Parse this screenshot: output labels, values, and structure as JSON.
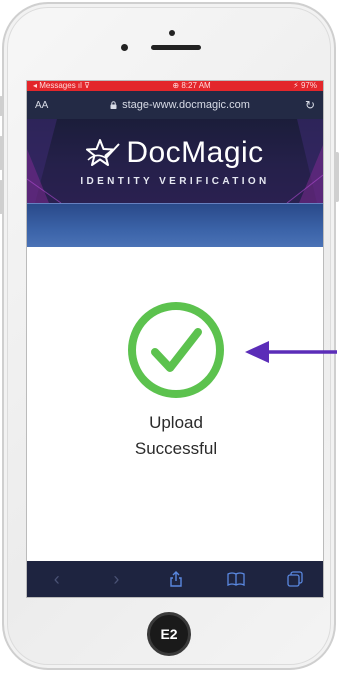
{
  "status_bar": {
    "left": "◂ Messages ıl ⊽",
    "time": "⊕ 8:27 AM",
    "right": "⚡ 97%"
  },
  "browser": {
    "text_size_label": "AA",
    "url": "stage-www.docmagic.com",
    "reload_icon": "reload-icon"
  },
  "brand": {
    "name": "DocMagic",
    "subtitle": "IDENTITY VERIFICATION",
    "logo_icon": "star-logo-icon"
  },
  "result": {
    "line1": "Upload",
    "line2": "Successful",
    "icon": "check-circle-icon",
    "color": "#5cc24e"
  },
  "toolbar": {
    "items": [
      "back-icon",
      "forward-icon",
      "share-icon",
      "bookmarks-icon",
      "tabs-icon"
    ]
  },
  "annotation": {
    "arrow_color": "#5b2db8",
    "badge_label": "E2"
  },
  "colors": {
    "header_bg": "#1b1d3a",
    "band_blue": "#3b63a8",
    "status_red": "#e3262b"
  }
}
